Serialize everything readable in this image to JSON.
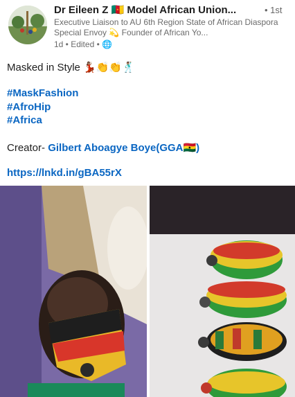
{
  "author": {
    "name": "Dr Eileen Z 🇨🇲 Model African Union...",
    "degree": "• 1st",
    "headline": "Executive Liaison to AU 6th Region State of African Diaspora Special Envoy 💫 Founder of African Yo...",
    "meta": "1d • Edited • 🌐"
  },
  "post": {
    "line1": "Masked in Style 💃🏽👏👏🕺🏽",
    "hashtags": [
      "#MaskFashion",
      "#AfroHip",
      "#Africa"
    ],
    "creator_prefix": "Creator- ",
    "creator_name": "Gilbert Aboagye Boye(GGA🇬🇭)",
    "url": "https://lnkd.in/gBA55rX"
  },
  "colors": {
    "link": "#0a66c2",
    "text": "#1d1d1d",
    "muted": "#6b6b6b"
  }
}
